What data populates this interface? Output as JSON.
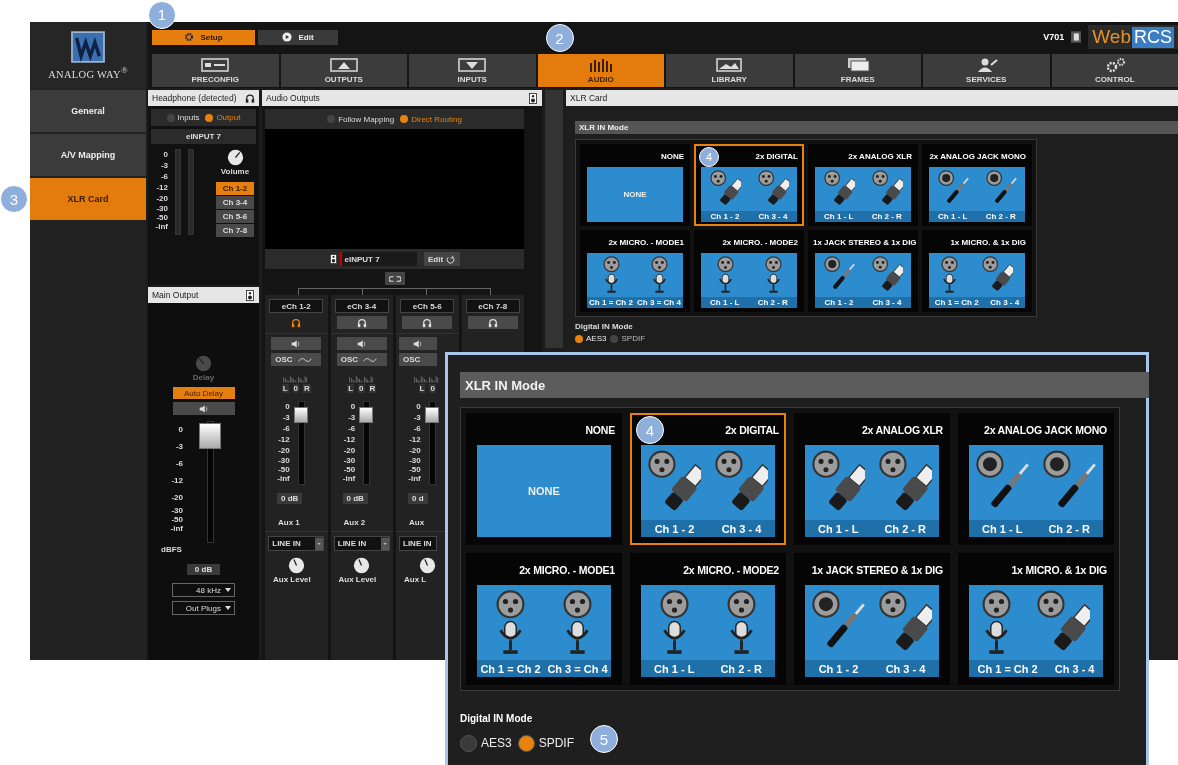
{
  "top_tabs": [
    {
      "label": "Setup",
      "selected": true,
      "callout": "1"
    },
    {
      "label": "Edit",
      "selected": false
    }
  ],
  "logo": "ANALOG WAY$^{®}$",
  "version": "V701",
  "brand": [
    "Web",
    "RCS"
  ],
  "nav_tabs": [
    {
      "label": "PRECONFIG",
      "selected": false
    },
    {
      "label": "OUTPUTS",
      "selected": false
    },
    {
      "label": "INPUTS",
      "selected": false
    },
    {
      "label": "AUDIO",
      "selected": true,
      "callout": "2"
    },
    {
      "label": "LIBRARY",
      "selected": false
    },
    {
      "label": "FRAMES",
      "selected": false
    },
    {
      "label": "SERVICES",
      "selected": false
    },
    {
      "label": "CONTROL",
      "selected": false
    }
  ],
  "sidebar": [
    {
      "label": "General",
      "selected": false
    },
    {
      "label": "A/V Mapping",
      "selected": false
    },
    {
      "label": "XLR Card",
      "selected": true,
      "callout": "3"
    }
  ],
  "headphone": {
    "title": "Headphone (detected)",
    "modes": [
      {
        "label": "Inputs",
        "selected": false
      },
      {
        "label": "Output",
        "selected": true
      }
    ],
    "source": "eINPUT 7",
    "scale": [
      "0",
      "-3",
      "-6",
      "-12",
      "-20",
      "-30",
      "-50",
      "-inf"
    ],
    "volume": "Volume",
    "channels": [
      {
        "label": "Ch 1-2",
        "selected": true
      },
      {
        "label": "Ch 3-4",
        "selected": false
      },
      {
        "label": "Ch 5-6",
        "selected": false
      },
      {
        "label": "Ch 7-8",
        "selected": false
      }
    ]
  },
  "main_output": {
    "title": "Main Output",
    "delay": {
      "label": "Delay",
      "disabled": true
    },
    "auto_delay": {
      "label": "Auto Delay",
      "on": true
    },
    "fader": {
      "level": 0.97
    },
    "scale": [
      "0",
      "-3",
      "-6",
      "-12",
      "-20",
      "-30",
      "-50",
      "-inf"
    ],
    "unit": "dBFS",
    "reading": "0 dB",
    "rate": "48 kHz",
    "plugs": "Out Plugs"
  },
  "audio_outputs": {
    "title": "Audio Outputs",
    "routing": [
      {
        "label": "Follow Mapping",
        "selected": false
      },
      {
        "label": "Direct Routing",
        "selected": true
      }
    ],
    "source": "eINPUT 7",
    "edit": "Edit",
    "strips": [
      {
        "name": "eCh 1-2",
        "monitor": true,
        "osc": "OSC",
        "pan": [
          "L",
          "0",
          "R"
        ],
        "scale": [
          "0",
          "-3",
          "-6",
          "-12",
          "-20",
          "-30",
          "-50",
          "-inf"
        ],
        "fader": {
          "level": 0.9
        },
        "reading": "0 dB",
        "aux": "Aux 1",
        "input": "LINE IN",
        "aux_level": "Aux Level"
      },
      {
        "name": "eCh 3-4",
        "monitor": false,
        "osc": "OSC",
        "pan": [
          "L",
          "0",
          "R"
        ],
        "scale": [
          "0",
          "-3",
          "-6",
          "-12",
          "-20",
          "-30",
          "-50",
          "-inf"
        ],
        "fader": {
          "level": 0.9
        },
        "reading": "0 dB",
        "aux": "Aux 2",
        "input": "LINE IN",
        "aux_level": "Aux Level"
      },
      {
        "name": "eCh 5-6",
        "monitor": false,
        "osc": "OSC",
        "pan": [
          "L",
          "0"
        ],
        "scale": [
          "0",
          "-3",
          "-6",
          "-12",
          "-20",
          "-30",
          "-50",
          "-inf"
        ],
        "fader": {
          "level": 0.9
        },
        "reading": "0 d",
        "aux": "Aux",
        "input": "LINE IN",
        "aux_level": "Aux L"
      },
      {
        "name": "eCh 7-8",
        "monitor": false
      }
    ]
  },
  "xlr_card": {
    "title": "XLR Card",
    "mode_title": "XLR IN Mode",
    "cards": [
      {
        "title": "NONE",
        "kind": "none",
        "selected": false,
        "text": "NONE"
      },
      {
        "title": "2x DIGITAL",
        "kind": "digital",
        "selected": true,
        "labels": [
          "Ch 1 - 2",
          "Ch 3 - 4"
        ],
        "callout": "4"
      },
      {
        "title": "2x ANALOG XLR",
        "kind": "analog_xlr",
        "selected": false,
        "labels": [
          "Ch 1 - L",
          "Ch 2 - R"
        ]
      },
      {
        "title": "2x ANALOG JACK MONO",
        "kind": "jack_mono",
        "selected": false,
        "labels": [
          "Ch 1 - L",
          "Ch 2 - R"
        ]
      },
      {
        "title": "2x MICRO. - MODE1",
        "kind": "mic_mode1",
        "selected": false,
        "labels": [
          "Ch 1 = Ch 2",
          "Ch 3 = Ch 4"
        ]
      },
      {
        "title": "2x MICRO. - MODE2",
        "kind": "mic_mode2",
        "selected": false,
        "labels": [
          "Ch 1 - L",
          "Ch 2 - R"
        ]
      },
      {
        "title": "1x JACK STEREO & 1x DIG",
        "kind": "jack_dig",
        "selected": false,
        "labels": [
          "Ch 1 - 2",
          "Ch 3 - 4"
        ]
      },
      {
        "title": "1x MICRO. & 1x DIG",
        "kind": "mic_dig",
        "selected": false,
        "labels": [
          "Ch 1 = Ch 2",
          "Ch 3 - 4"
        ]
      }
    ],
    "digital_title": "Digital IN Mode",
    "digital": [
      {
        "label": "AES3",
        "selected": true
      },
      {
        "label": "SPDIF",
        "selected": false
      }
    ]
  },
  "zoom": {
    "mode_title": "XLR IN Mode",
    "cards": [
      {
        "title": "NONE",
        "kind": "none",
        "selected": false,
        "text": "NONE"
      },
      {
        "title": "2x DIGITAL",
        "kind": "digital",
        "selected": true,
        "labels": [
          "Ch 1 - 2",
          "Ch 3 - 4"
        ],
        "callout": "4"
      },
      {
        "title": "2x ANALOG XLR",
        "kind": "analog_xlr",
        "selected": false,
        "labels": [
          "Ch 1 - L",
          "Ch 2 - R"
        ]
      },
      {
        "title": "2x ANALOG JACK MONO",
        "kind": "jack_mono",
        "selected": false,
        "labels": [
          "Ch 1 - L",
          "Ch 2 - R"
        ]
      },
      {
        "title": "2x MICRO. - MODE1",
        "kind": "mic_mode1",
        "selected": false,
        "labels": [
          "Ch 1 = Ch 2",
          "Ch 3 = Ch 4"
        ]
      },
      {
        "title": "2x MICRO. - MODE2",
        "kind": "mic_mode2",
        "selected": false,
        "labels": [
          "Ch 1 - L",
          "Ch 2 - R"
        ]
      },
      {
        "title": "1x JACK STEREO & 1x DIG",
        "kind": "jack_dig",
        "selected": false,
        "labels": [
          "Ch 1 - 2",
          "Ch 3 - 4"
        ]
      },
      {
        "title": "1x MICRO. & 1x DIG",
        "kind": "mic_dig",
        "selected": false,
        "labels": [
          "Ch 1 = Ch 2",
          "Ch 3 - 4"
        ]
      }
    ],
    "digital_title": "Digital IN Mode",
    "digital": [
      {
        "label": "AES3",
        "selected": false
      },
      {
        "label": "SPDIF",
        "selected": true
      }
    ],
    "callout": "5"
  }
}
